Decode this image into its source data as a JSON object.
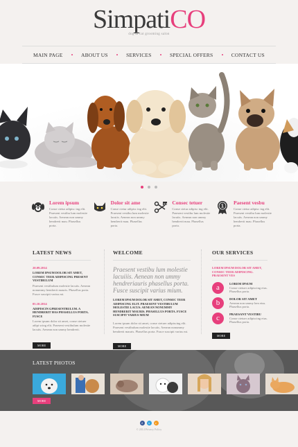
{
  "logo": {
    "part1": "Simpati",
    "part2": "CO",
    "tagline": "dog & cat grooming salon"
  },
  "nav": {
    "items": [
      "MAIN PAGE",
      "ABOUT US",
      "SERVICES",
      "SPECIAL OFFERS",
      "CONTACT US"
    ]
  },
  "colors": {
    "accent": "#e73f7c",
    "dark": "#333333",
    "photos_band": "#585858"
  },
  "slider": {
    "total": 3,
    "active": 1
  },
  "features": [
    {
      "icon": "dog-icon",
      "title": "Lorem ipsum",
      "text": "Conse ctetur adipisc ing elit. Praesent vestibu lum molestie lacuiis. Aenean non ummy hendrerit mau. Phasellus porta."
    },
    {
      "icon": "cat-icon",
      "title": "Dolor sit ame",
      "text": "Conse ctetur adipisc ing elit. Praesent vestibu lum molestie lacuiis. Aenean non ummy hendrerit mau. Phasellus porta."
    },
    {
      "icon": "scissors-comb-icon",
      "title": "Consec tetuer",
      "text": "Conse ctetur adipisc ing elit. Praesent vestibu lum molestie lacuiis. Aenean non ummy hendrerit mau. Phasellus porta."
    },
    {
      "icon": "award-ribbon-icon",
      "title": "Paesent vesbu",
      "text": "Conse ctetur adipisc ing elit. Praesent vestibu lum molestie lacuiis. Aenean non ummy hendrerit mau. Phasellus porta."
    }
  ],
  "news": {
    "heading": "LATEST NEWS",
    "items": [
      {
        "date": "20.09.2014",
        "title": "LOREM IPSUM DOLOR SIT AMET, CONSEC TEER ADIPISCING PRESENT VESTIBULUM",
        "text": "Praesent vestibulum molestie lacuiis. Aenean nonummy hendrerit mauris. Phasellus porta. Fusce suscipit varius mi."
      },
      {
        "date": "05.10.2014",
        "title": "ADIPISCIN GPRESENTBULUM. A HENDRERIT HAS PHASELLUS PORTA. FUSCE",
        "text": "Lorem ipsum dolor sit amet, conse ctetuer adipi scing elit. Praesent vestibulum molestie lacuiis. Aenean non ummy hendrerit."
      }
    ],
    "more": "MORE"
  },
  "welcome": {
    "heading": "WELCOME",
    "lead": "Praesent vestibu lum molestie lacuiiis. Aenean non ummy hendreriauris phasellus porta. Fusce suscipit varius mium.",
    "caps": "LOREM IPSUM DOLOR SIT AMET, CONSEC TEER ADIPISCING ELIT. PRAESENT VESTIBULUM MOLESTIE LACUS. AENEAN NONUMMY HENDRERIT MAURIS. PHASELLUS PORTA. FUSCE SUSCIPIT VARIUS MIUM",
    "text": "Lorem ipsum dolor sit amet, conse ctetuer adipiscing elit. Praesent vestibulum molestie lacuiis. Aenean nonummy hendrerit mauris. Phasellus porta. Fusce suscipit varius mi.",
    "more": "MORE"
  },
  "services": {
    "heading": "OUR SERVICES",
    "caps": "LOREM IPSUM DOLOR SIT AMET, CONSEC TEER ADIPISCING. PRAESENT VES",
    "items": [
      {
        "badge": "a",
        "title": "LOREM IPSUM",
        "text": "Conse ctetuer adipiscing eius. Phasellus porta."
      },
      {
        "badge": "b",
        "title": "DOLOR SIT AMET",
        "text": "Aenean non ummy hen eius. Phasellus porta."
      },
      {
        "badge": "c",
        "title": "PRAESANT VESTIBU",
        "text": "Conse ctetuer adipiscing eius. Phasellus porta."
      }
    ],
    "more": "MORE"
  },
  "photos": {
    "heading": "LATEST PHOTOS",
    "more": "MORE"
  },
  "social": {
    "items": [
      {
        "icon": "facebook-icon",
        "glyph": "f",
        "color": "#3b5998"
      },
      {
        "icon": "twitter-icon",
        "glyph": "t",
        "color": "#33a5e0"
      },
      {
        "icon": "rss-icon",
        "glyph": "r",
        "color": "#f49b22"
      }
    ]
  },
  "footer": {
    "text": "© 2014 Privacy Policy"
  }
}
